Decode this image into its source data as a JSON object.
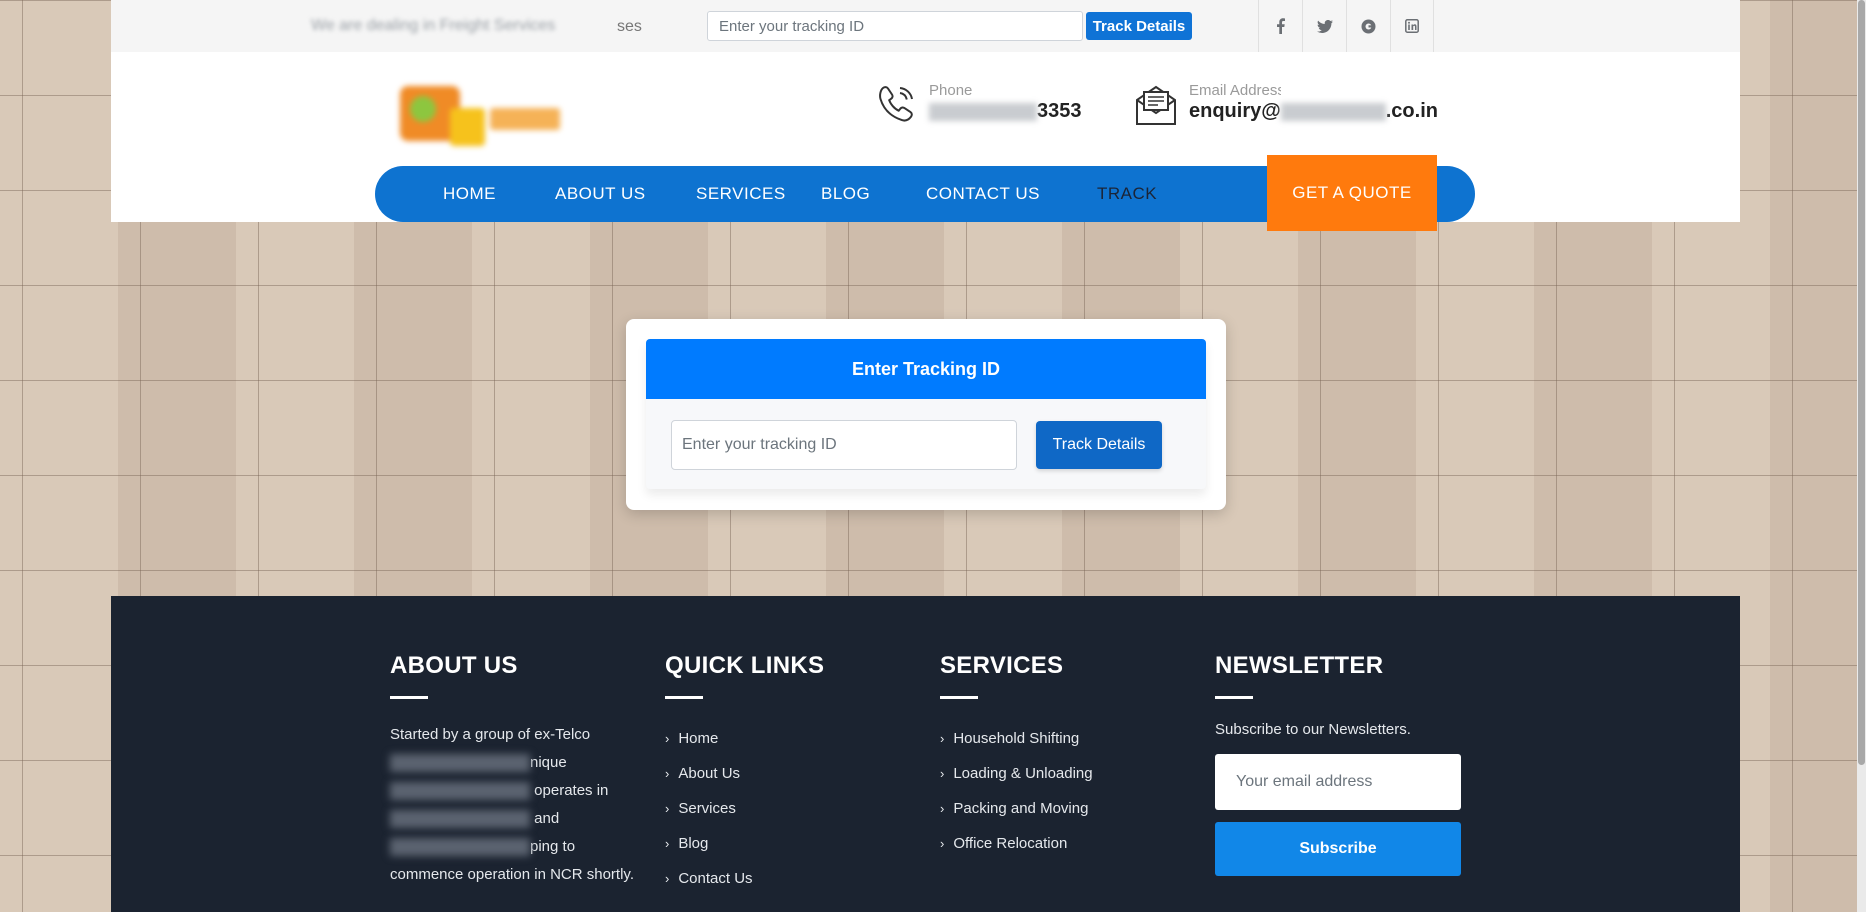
{
  "topbar": {
    "tagline_visible": "ses",
    "tagline_blurred": "We are dealing in Freight Services",
    "tracking_placeholder": "Enter your tracking ID",
    "track_button": "Track Details",
    "socials": [
      "facebook-icon",
      "twitter-icon",
      "google-plus-icon",
      "linkedin-icon"
    ]
  },
  "header": {
    "phone_label": "Phone",
    "phone_value_end": "3353",
    "email_label": "Email Address",
    "email_value_start": "enquiry@",
    "email_value_end": ".co.in"
  },
  "nav": {
    "items": [
      "HOME",
      "ABOUT US",
      "SERVICES",
      "BLOG",
      "CONTACT US",
      "TRACK"
    ],
    "active": "TRACK",
    "quote_button": "GET A QUOTE"
  },
  "tracking_card": {
    "title": "Enter Tracking ID",
    "placeholder": "Enter your tracking ID",
    "button": "Track Details"
  },
  "footer": {
    "about": {
      "heading": "ABOUT US",
      "lines": [
        "Started by a group of ex-Telco",
        "nique",
        "operates in",
        "and",
        "ping to",
        "commence operation in NCR shortly."
      ]
    },
    "quick_links": {
      "heading": "QUICK LINKS",
      "items": [
        "Home",
        "About Us",
        "Services",
        "Blog",
        "Contact Us"
      ]
    },
    "services": {
      "heading": "SERVICES",
      "items": [
        "Household Shifting",
        "Loading & Unloading",
        "Packing and Moving",
        "Office Relocation"
      ]
    },
    "newsletter": {
      "heading": "NEWSLETTER",
      "text": "Subscribe to our Newsletters.",
      "placeholder": "Your email address",
      "button": "Subscribe"
    }
  },
  "colors": {
    "brand_blue": "#0e73d0",
    "accent_orange": "#ff7a0d",
    "footer_bg": "#1b2330",
    "card_header": "#007bff"
  }
}
